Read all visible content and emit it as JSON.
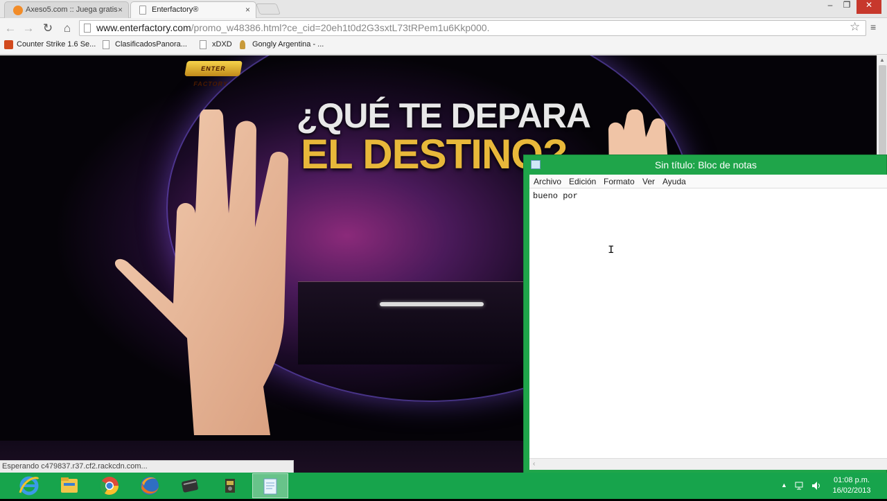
{
  "browser": {
    "tabs": [
      {
        "title": "Axeso5.com :: Juega gratis",
        "close": "×"
      },
      {
        "title": "Enterfactory®",
        "close": "×"
      }
    ],
    "window_controls": {
      "minimize": "–",
      "restore": "❐",
      "close": "✕"
    },
    "nav": {
      "back": "←",
      "forward": "→",
      "reload": "↻",
      "home": "⌂"
    },
    "url_host": "www.enterfactory.com",
    "url_path": "/promo_w48386.html?ce_cid=20eh1t0d2G3sxtL73tRPem1u6Kkp000.",
    "star": "☆",
    "menu": "≡",
    "bookmarks": [
      "Counter Strike 1.6 Se...",
      "ClasificadosPanora...",
      "xDXD",
      "Gongly Argentina - ..."
    ],
    "status_text": "Esperando c479837.r37.cf2.rackcdn.com..."
  },
  "page": {
    "logo_text": "ENTER FACTORY",
    "headline_line1": "¿QUÉ TE DEPARA",
    "headline_line2": "EL DESTINO?"
  },
  "notepad": {
    "title": "Sin título: Bloc de notas",
    "menu": [
      "Archivo",
      "Edición",
      "Formato",
      "Ver",
      "Ayuda"
    ],
    "content": "bueno por",
    "scroll_arrow": "‹"
  },
  "taskbar": {
    "apps": [
      "internet-explorer",
      "file-explorer",
      "chrome",
      "firefox",
      "app-4",
      "app-5",
      "notepad"
    ],
    "tray_arrow": "▲",
    "clock_time": "01:08 p.m.",
    "clock_date": "16/02/2013"
  },
  "colors": {
    "taskbar_green": "#17a44c",
    "notepad_frame": "#1fa54a",
    "headline_gold": "#e8b83a"
  }
}
